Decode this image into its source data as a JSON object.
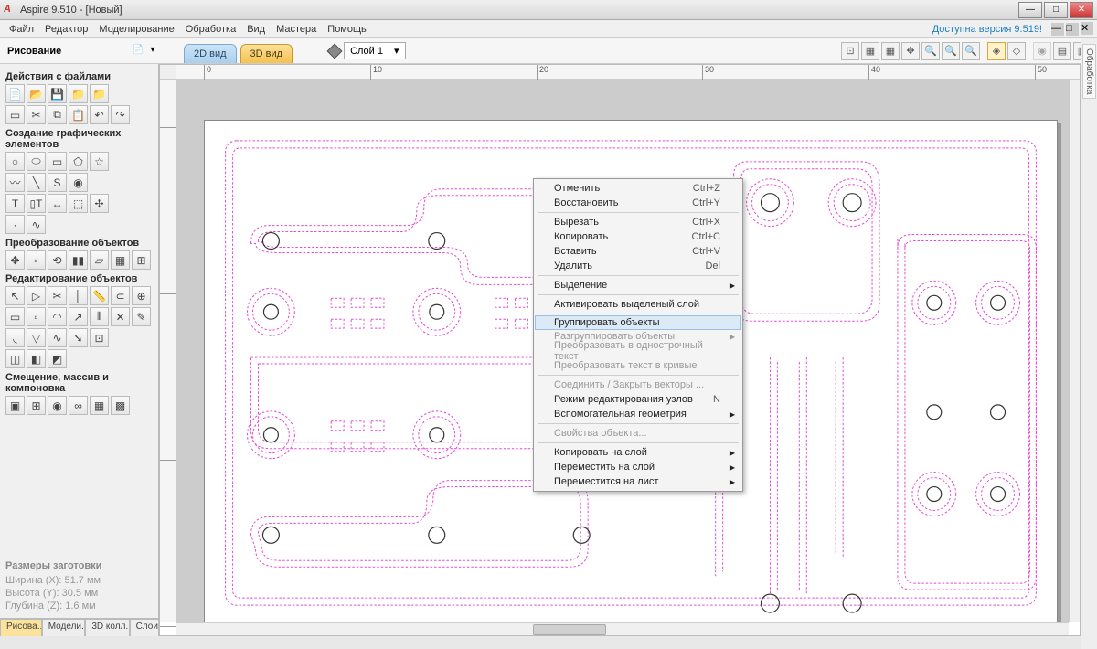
{
  "titlebar": {
    "app_icon": "A",
    "title": "Aspire 9.510 - [Новый]"
  },
  "menubar": {
    "items": [
      "Файл",
      "Редактор",
      "Моделирование",
      "Обработка",
      "Вид",
      "Мастера",
      "Помощь"
    ],
    "version_text": "Доступна версия 9.519!"
  },
  "toolbar": {
    "panel_title": "Рисование",
    "tabs": [
      {
        "label": "2D вид",
        "active": false
      },
      {
        "label": "3D вид",
        "active": true
      }
    ],
    "layer_label": "Слой 1"
  },
  "rulers": {
    "marks": [
      "0",
      "10",
      "20",
      "30",
      "40",
      "50"
    ]
  },
  "left_panel": {
    "sections": {
      "files": "Действия с файлами",
      "create": "Создание графических элементов",
      "transform": "Преобразование объектов",
      "edit": "Редактирование объектов",
      "offset": "Смещение, массив и компоновка"
    }
  },
  "footer": {
    "title": "Размеры заготовки",
    "w": "Ширина  (X): 51.7 мм",
    "h": "Высота  (Y): 30.5 мм",
    "d": "Глубина (Z): 1.6 мм"
  },
  "bottom_tabs": [
    "Рисова...",
    "Модели...",
    "3D колл...",
    "Слои"
  ],
  "right_tab": "Обработка",
  "context_menu": [
    {
      "type": "item",
      "label": "Отменить",
      "shortcut": "Ctrl+Z"
    },
    {
      "type": "item",
      "label": "Восстановить",
      "shortcut": "Ctrl+Y"
    },
    {
      "type": "sep"
    },
    {
      "type": "item",
      "label": "Вырезать",
      "shortcut": "Ctrl+X"
    },
    {
      "type": "item",
      "label": "Копировать",
      "shortcut": "Ctrl+C"
    },
    {
      "type": "item",
      "label": "Вставить",
      "shortcut": "Ctrl+V"
    },
    {
      "type": "item",
      "label": "Удалить",
      "shortcut": "Del"
    },
    {
      "type": "sep"
    },
    {
      "type": "item",
      "label": "Выделение",
      "sub": true
    },
    {
      "type": "sep"
    },
    {
      "type": "item",
      "label": "Активировать выделеный слой"
    },
    {
      "type": "sep"
    },
    {
      "type": "item",
      "label": "Группировать объекты",
      "hover": true
    },
    {
      "type": "item",
      "label": "Разгруппировать объекты",
      "disabled": true,
      "sub": true
    },
    {
      "type": "item",
      "label": "Преобразовать в однострочный текст",
      "disabled": true
    },
    {
      "type": "item",
      "label": "Преобразовать текст в кривые",
      "disabled": true
    },
    {
      "type": "sep"
    },
    {
      "type": "item",
      "label": "Соединить / Закрыть векторы ...",
      "disabled": true
    },
    {
      "type": "item",
      "label": "Режим редактирования узлов",
      "shortcut": "N"
    },
    {
      "type": "item",
      "label": "Вспомогательная геометрия",
      "sub": true
    },
    {
      "type": "sep"
    },
    {
      "type": "item",
      "label": "Свойства объекта...",
      "disabled": true
    },
    {
      "type": "sep"
    },
    {
      "type": "item",
      "label": "Копировать на слой",
      "sub": true
    },
    {
      "type": "item",
      "label": "Переместить на слой",
      "sub": true
    },
    {
      "type": "item",
      "label": "Переместится на лист",
      "sub": true
    }
  ]
}
